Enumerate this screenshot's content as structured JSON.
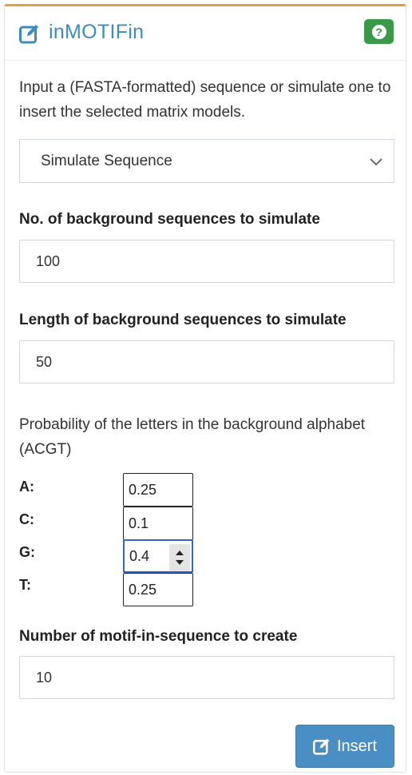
{
  "header": {
    "title": "inMOTIFin",
    "help_label": "?"
  },
  "intro_text": "Input a (FASTA-formatted) sequence or simulate one to insert the selected matrix models.",
  "mode_select": {
    "selected": "Simulate Sequence"
  },
  "fields": {
    "num_background": {
      "label": "No. of background sequences to simulate",
      "value": "100"
    },
    "length_background": {
      "label": "Length of background sequences to simulate",
      "value": "50"
    }
  },
  "probabilities": {
    "label": "Probability of the letters in the background alphabet (ACGT)",
    "letters": [
      {
        "name": "A:",
        "value": "0.25"
      },
      {
        "name": "C:",
        "value": "0.1"
      },
      {
        "name": "G:",
        "value": "0.4"
      },
      {
        "name": "T:",
        "value": "0.25"
      }
    ]
  },
  "motif_count": {
    "label": "Number of motif-in-sequence to create",
    "value": "10"
  },
  "insert_button": {
    "label": "Insert"
  },
  "colors": {
    "accent": "#e0a23a",
    "title": "#3c8dbc",
    "help": "#3a9a4a",
    "button": "#4a8fc4"
  },
  "icons": {
    "title": "edit-icon",
    "help": "question-icon",
    "select": "chevron-down-icon",
    "insert": "edit-icon"
  }
}
